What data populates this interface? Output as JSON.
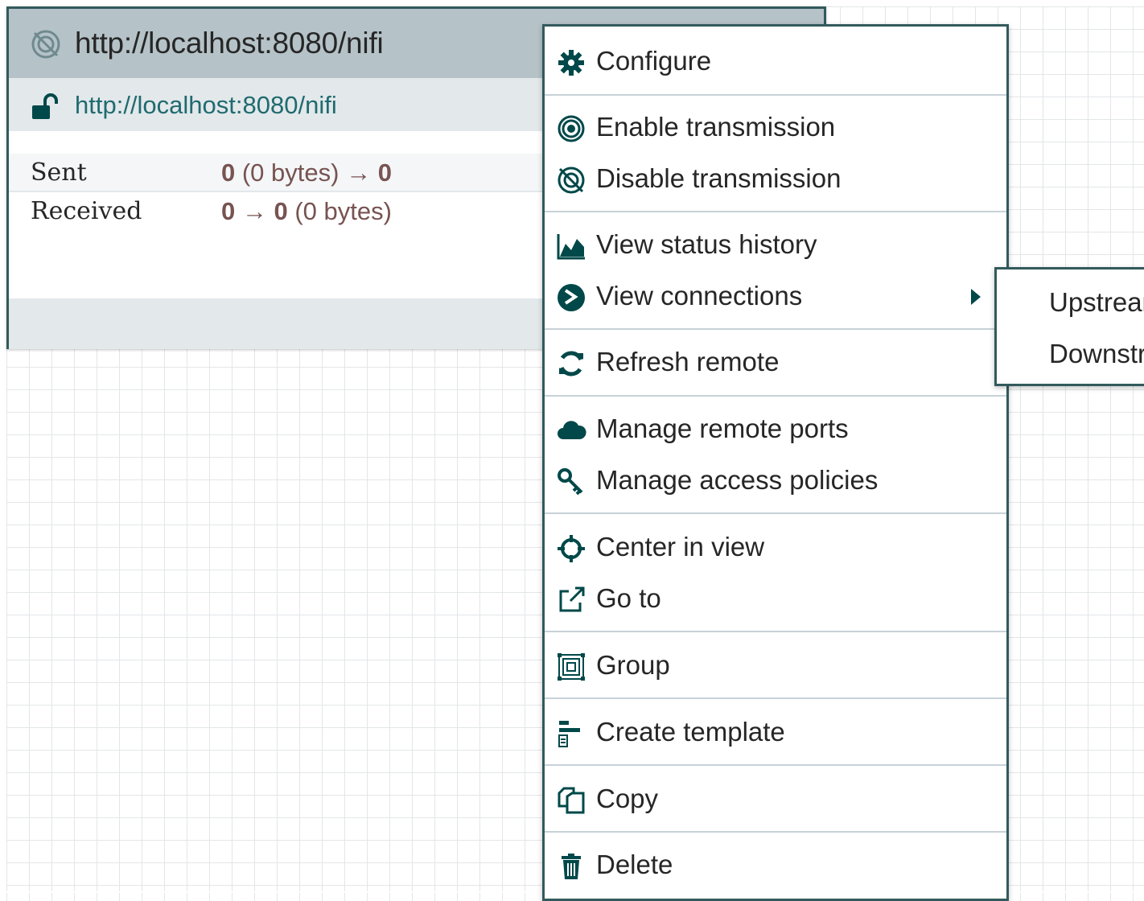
{
  "remote_group": {
    "title": "http://localhost:8080/nifi",
    "target_uri": "http://localhost:8080/nifi",
    "stats": {
      "sent_label": "Sent",
      "sent_count": "0",
      "sent_bytes": " (0 bytes) → ",
      "sent_flow": "0",
      "received_label": "Received",
      "received_value": "0 → 0",
      "received_bytes": " (0 bytes)"
    }
  },
  "context_menu": {
    "items": [
      {
        "label": "Configure",
        "icon": "gear-icon"
      },
      {
        "label": "Enable transmission",
        "icon": "transmit-enable-icon"
      },
      {
        "label": "Disable transmission",
        "icon": "transmit-disable-icon"
      },
      {
        "label": "View status history",
        "icon": "area-chart-icon"
      },
      {
        "label": "View connections",
        "icon": "connections-icon"
      },
      {
        "label": "Refresh remote",
        "icon": "refresh-icon"
      },
      {
        "label": "Manage remote ports",
        "icon": "cloud-icon"
      },
      {
        "label": "Manage access policies",
        "icon": "key-icon"
      },
      {
        "label": "Center in view",
        "icon": "crosshair-icon"
      },
      {
        "label": "Go to",
        "icon": "external-link-icon"
      },
      {
        "label": "Group",
        "icon": "group-icon"
      },
      {
        "label": "Create template",
        "icon": "template-icon"
      },
      {
        "label": "Copy",
        "icon": "copy-icon"
      },
      {
        "label": "Delete",
        "icon": "trash-icon"
      }
    ]
  },
  "submenu": {
    "upstream": "Upstream",
    "downstream": "Downstream"
  },
  "colors": {
    "border": "#325a5c",
    "header_bg": "#b5c2c7",
    "link": "#1f6b6f",
    "stat_value": "#775351"
  }
}
